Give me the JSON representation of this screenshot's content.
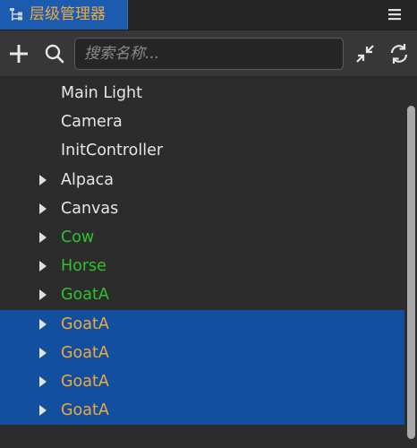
{
  "panel": {
    "title": "层级管理器",
    "accent_color": "#f2a93b",
    "tab_color": "#1b5cb0"
  },
  "toolbar": {
    "add_icon": "plus-icon",
    "search_icon": "search-icon",
    "search_placeholder": "搜索名称...",
    "search_value": "",
    "collapse_icon": "collapse-icon",
    "refresh_icon": "refresh-icon"
  },
  "tree": {
    "items": [
      {
        "label": "Main Light",
        "color": "#e6e6e6",
        "has_children": false,
        "selected": false
      },
      {
        "label": "Camera",
        "color": "#e6e6e6",
        "has_children": false,
        "selected": false
      },
      {
        "label": "InitController",
        "color": "#e6e6e6",
        "has_children": false,
        "selected": false
      },
      {
        "label": "Alpaca",
        "color": "#e6e6e6",
        "has_children": true,
        "selected": false
      },
      {
        "label": "Canvas",
        "color": "#e6e6e6",
        "has_children": true,
        "selected": false
      },
      {
        "label": "Cow",
        "color": "#2fc22f",
        "has_children": true,
        "selected": false
      },
      {
        "label": "Horse",
        "color": "#2fc22f",
        "has_children": true,
        "selected": false
      },
      {
        "label": "GoatA",
        "color": "#2fc22f",
        "has_children": true,
        "selected": false
      },
      {
        "label": "GoatA",
        "color": "#f2a93b",
        "has_children": true,
        "selected": true
      },
      {
        "label": "GoatA",
        "color": "#f2a93b",
        "has_children": true,
        "selected": true
      },
      {
        "label": "GoatA",
        "color": "#f2a93b",
        "has_children": true,
        "selected": true
      },
      {
        "label": "GoatA",
        "color": "#f2a93b",
        "has_children": true,
        "selected": true
      }
    ]
  },
  "colors": {
    "selection": "#12509f",
    "prefab_green": "#2fc22f"
  }
}
